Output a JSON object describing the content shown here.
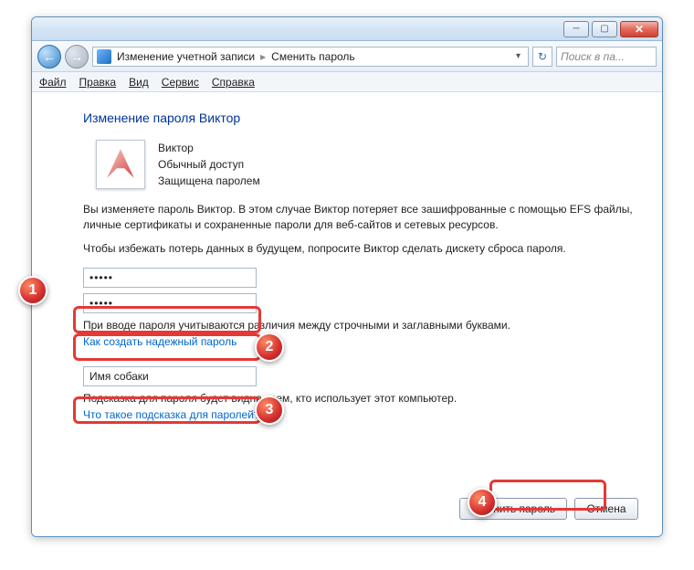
{
  "titlebar": {
    "minimize": "─",
    "maximize": "▢",
    "close": "✕"
  },
  "nav": {
    "back": "←",
    "forward": "→",
    "refresh": "↻",
    "breadcrumb1": "Изменение учетной записи",
    "breadcrumb2": "Сменить пароль",
    "search_placeholder": "Поиск в па..."
  },
  "menu": {
    "file": "Файл",
    "edit": "Правка",
    "view": "Вид",
    "tools": "Сервис",
    "help": "Справка"
  },
  "page": {
    "title": "Изменение пароля Виктор",
    "user_name": "Виктор",
    "user_access": "Обычный доступ",
    "user_protected": "Защищена паролем",
    "warn1": "Вы изменяете пароль Виктор. В этом случае Виктор потеряет все зашифрованные с помощью EFS файлы, личные сертификаты и сохраненные пароли для веб-сайтов и сетевых ресурсов.",
    "warn2": "Чтобы избежать потерь данных в будущем, попросите Виктор сделать дискету сброса пароля.",
    "pwd1_value": "●●●●●",
    "pwd2_value": "●●●●●",
    "case_note": "При вводе пароля учитываются различия между строчными и заглавными буквами.",
    "link_strong": "Как создать надежный пароль",
    "hint_value": "Имя собаки",
    "hint_note": "Подсказка для пароля будет видна всем, кто использует этот компьютер.",
    "link_hint": "Что такое подсказка для паролей?"
  },
  "buttons": {
    "change": "Сменить пароль",
    "cancel": "Отмена"
  },
  "markers": {
    "m1": "1",
    "m2": "2",
    "m3": "3",
    "m4": "4"
  }
}
